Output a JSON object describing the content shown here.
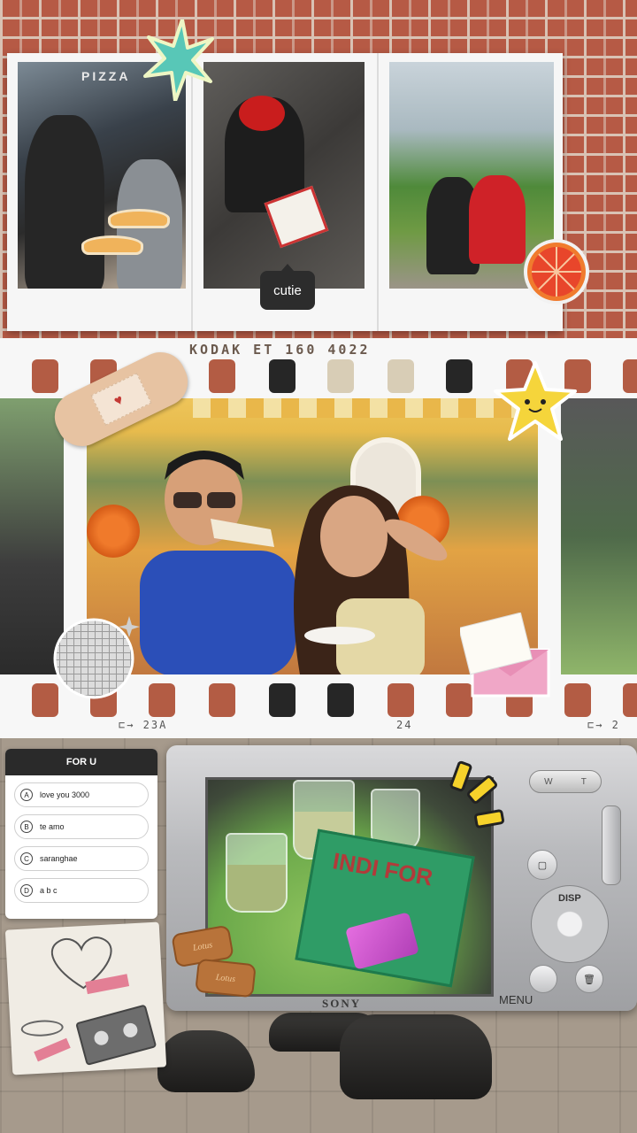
{
  "collage": {
    "polaroids": {
      "photo1_sign": "PIZZA",
      "caption_sticker": "cutie"
    },
    "film_strip": {
      "label": "KODAK ET 160 4022",
      "frame_numbers": [
        "⊏→ 23A",
        "24",
        "⊏→ 2"
      ]
    },
    "poll": {
      "title": "FOR U",
      "options": [
        {
          "letter": "A",
          "text": "love you 3000"
        },
        {
          "letter": "B",
          "text": "te amo"
        },
        {
          "letter": "C",
          "text": "saranghae"
        },
        {
          "letter": "D",
          "text": "a b c"
        }
      ]
    },
    "camera": {
      "brand": "SONY",
      "menu_label": "MENU",
      "disp_label": "DISP",
      "zoom_w": "W",
      "zoom_t": "T",
      "book_title": "INDI FOR",
      "biscuit_text": "Lotus"
    }
  }
}
